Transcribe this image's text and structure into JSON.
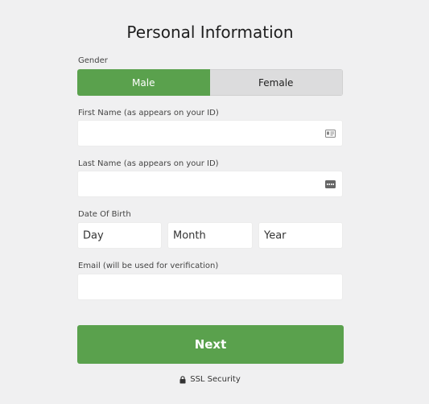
{
  "form": {
    "title": "Personal Information",
    "gender": {
      "label": "Gender",
      "options": [
        "Male",
        "Female"
      ],
      "selected": "Male"
    },
    "first_name": {
      "label": "First Name (as appears on your ID)",
      "value": "",
      "icon": "id-card-icon"
    },
    "last_name": {
      "label": "Last Name (as appears on your ID)",
      "value": "",
      "icon": "contact-card-icon"
    },
    "dob": {
      "label": "Date Of Birth",
      "day_placeholder": "Day",
      "month_placeholder": "Month",
      "year_placeholder": "Year"
    },
    "email": {
      "label": "Email (will be used for verification)",
      "value": ""
    },
    "next_button": "Next",
    "security_note": "SSL Security",
    "colors": {
      "accent": "#5aa14d",
      "background": "#f0f0f1",
      "unselected": "#dcdcdd"
    }
  }
}
